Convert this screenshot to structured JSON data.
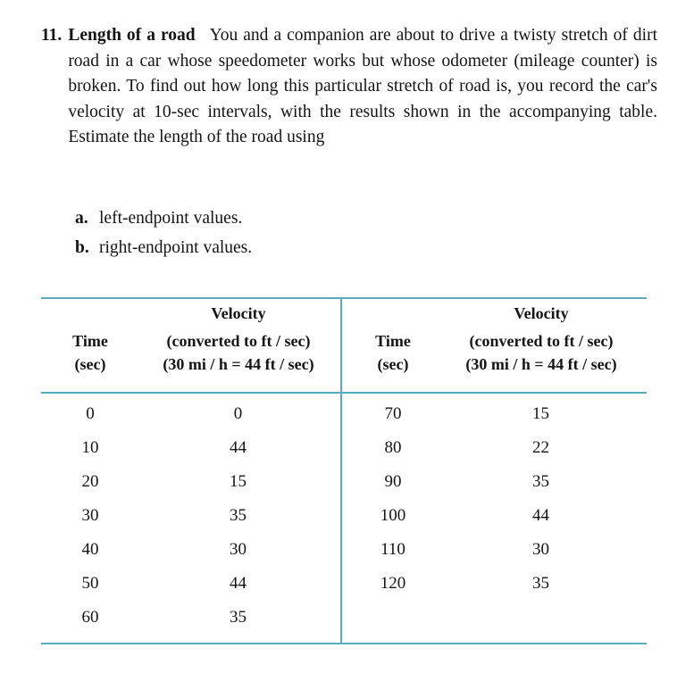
{
  "problem": {
    "number": "11.",
    "title": "Length of a road",
    "body": "You and a companion are about to drive a twisty stretch of dirt road in a car whose speedometer works but whose odometer (mileage counter) is broken. To find out how long this particular stretch of road is, you record the car's velocity at 10-sec intervals, with the results shown in the accompanying table. Estimate the length of the road using",
    "subparts": [
      {
        "marker": "a.",
        "text": "left-endpoint values."
      },
      {
        "marker": "b.",
        "text": "right-endpoint values."
      }
    ]
  },
  "table": {
    "rule_color": "#5aacbd",
    "headers": {
      "velocity_title": "Velocity",
      "time_line1": "Time",
      "time_line2": "(sec)",
      "velocity_line1": "(converted to ft / sec)",
      "velocity_line2": "(30 mi / h  =  44 ft / sec)"
    },
    "left": {
      "rows": [
        {
          "time": "0",
          "velocity": "0"
        },
        {
          "time": "10",
          "velocity": "44"
        },
        {
          "time": "20",
          "velocity": "15"
        },
        {
          "time": "30",
          "velocity": "35"
        },
        {
          "time": "40",
          "velocity": "30"
        },
        {
          "time": "50",
          "velocity": "44"
        },
        {
          "time": "60",
          "velocity": "35"
        }
      ]
    },
    "right": {
      "rows": [
        {
          "time": "70",
          "velocity": "15"
        },
        {
          "time": "80",
          "velocity": "22"
        },
        {
          "time": "90",
          "velocity": "35"
        },
        {
          "time": "100",
          "velocity": "44"
        },
        {
          "time": "110",
          "velocity": "30"
        },
        {
          "time": "120",
          "velocity": "35"
        }
      ]
    }
  },
  "chart_data": {
    "type": "table",
    "title": "Velocity (converted to ft / sec)",
    "xlabel": "Time (sec)",
    "ylabel": "Velocity (ft/sec)",
    "x": [
      0,
      10,
      20,
      30,
      40,
      50,
      60,
      70,
      80,
      90,
      100,
      110,
      120
    ],
    "values": [
      0,
      44,
      15,
      35,
      30,
      44,
      35,
      15,
      22,
      35,
      44,
      30,
      35
    ],
    "note": "30 mi / h = 44 ft / sec"
  }
}
